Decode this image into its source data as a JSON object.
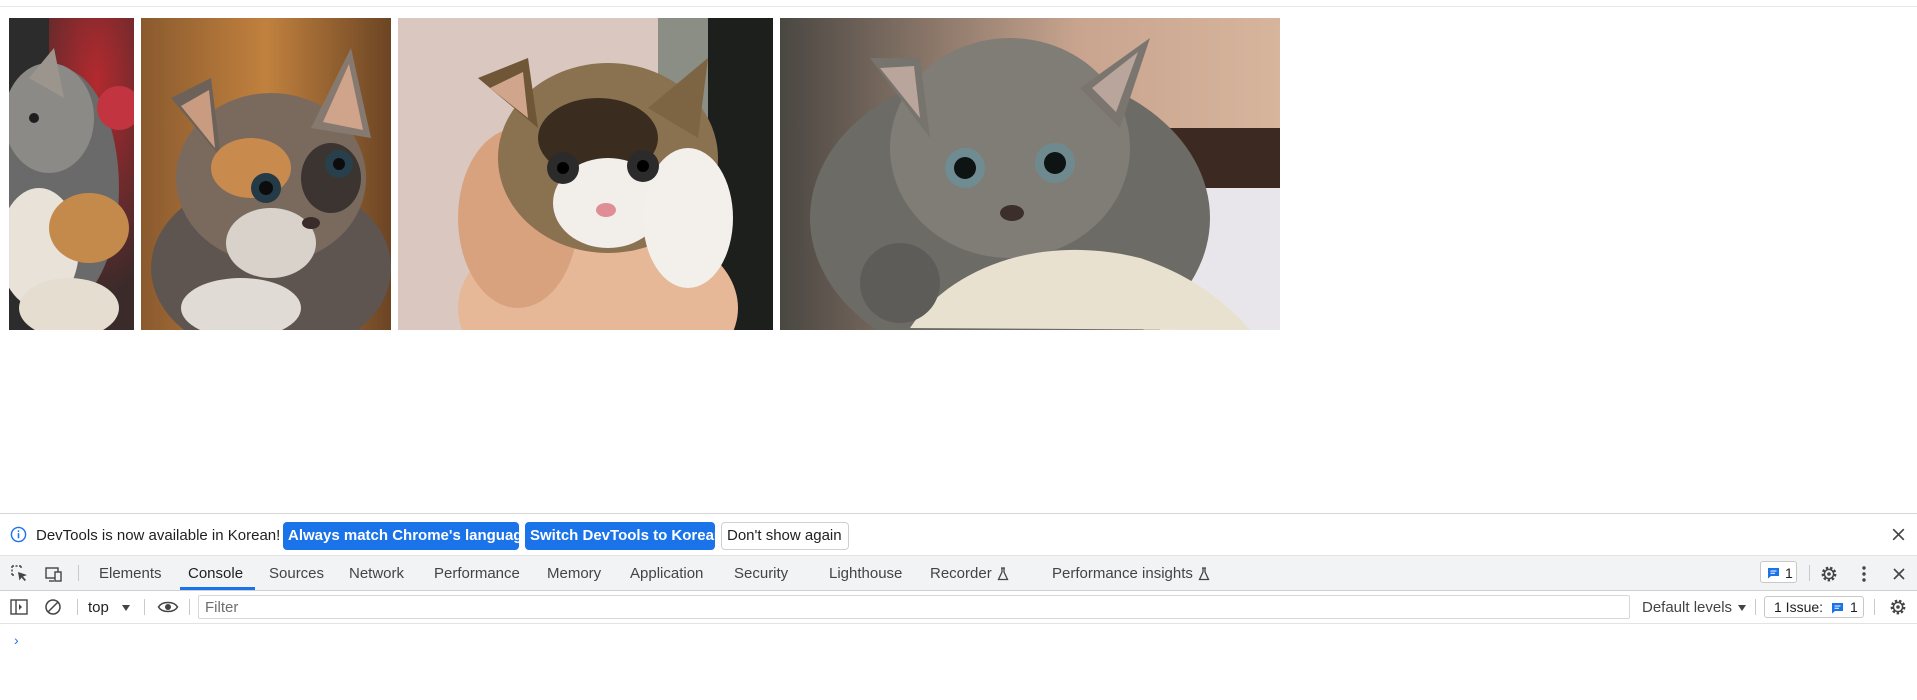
{
  "images": [
    {
      "name": "kitten-photo-1",
      "alt": "calico kitten partial"
    },
    {
      "name": "kitten-photo-2",
      "alt": "calico kitten"
    },
    {
      "name": "kitten-photo-3",
      "alt": "tabby kitten held in hand"
    },
    {
      "name": "kitten-photo-4",
      "alt": "grey fluffy kitten"
    }
  ],
  "infobar": {
    "message": "DevTools is now available in Korean!",
    "match_language_label": "Always match Chrome's language",
    "switch_label": "Switch DevTools to Korean",
    "dont_show_label": "Don't show again",
    "icon": "info-icon"
  },
  "tabs": {
    "items": [
      {
        "label": "Elements"
      },
      {
        "label": "Console",
        "active": true
      },
      {
        "label": "Sources"
      },
      {
        "label": "Network"
      },
      {
        "label": "Performance"
      },
      {
        "label": "Memory"
      },
      {
        "label": "Application"
      },
      {
        "label": "Security"
      },
      {
        "label": "Lighthouse"
      },
      {
        "label": "Recorder",
        "icon": "flask-icon"
      },
      {
        "label": "Performance insights",
        "icon": "flask-icon"
      }
    ],
    "messages_count": "1"
  },
  "console": {
    "context": "top",
    "filter_placeholder": "Filter",
    "filter_value": "",
    "levels": "Default levels",
    "issues_label": "1 Issue:",
    "issues_count": "1",
    "prompt": "›"
  },
  "colors": {
    "accent": "#1a73e8",
    "tabbar_bg": "#f1f3f4"
  }
}
